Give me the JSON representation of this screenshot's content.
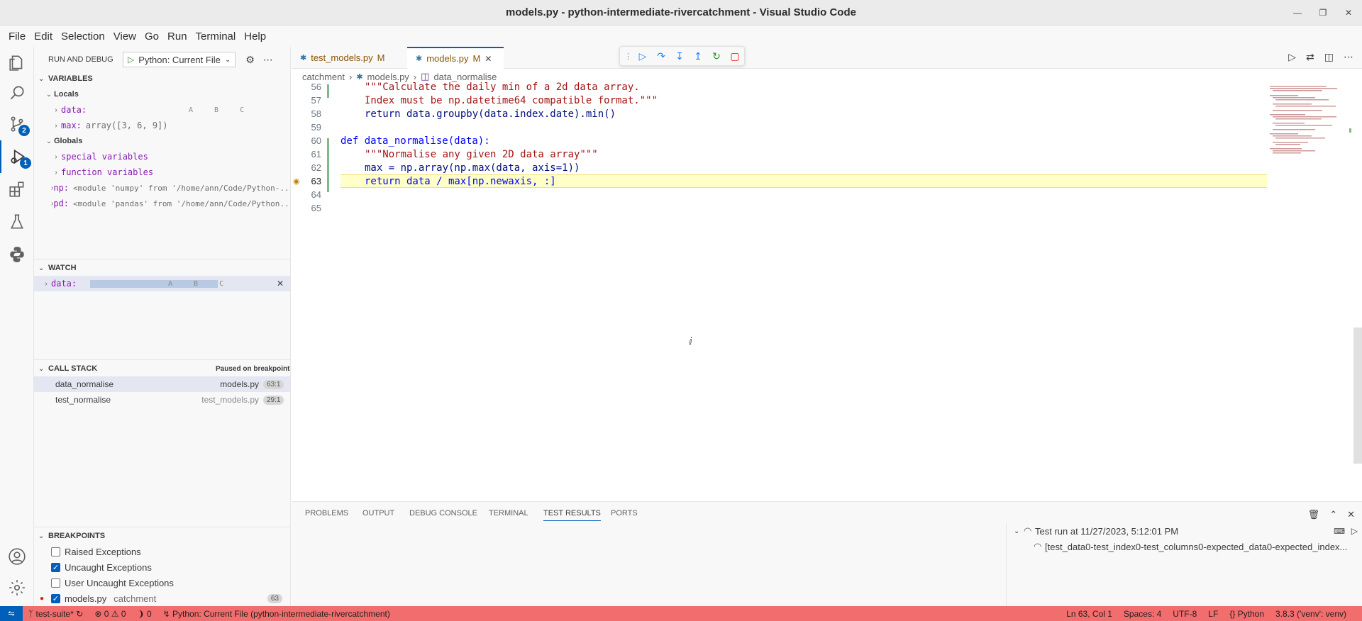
{
  "window": {
    "title": "models.py - python-intermediate-rivercatchment - Visual Studio Code"
  },
  "menu": [
    "File",
    "Edit",
    "Selection",
    "View",
    "Go",
    "Run",
    "Terminal",
    "Help"
  ],
  "activity": {
    "scm_badge": "2",
    "debug_badge": "1"
  },
  "sidebar": {
    "title": "RUN AND DEBUG",
    "config": "Python: Current File",
    "variables": {
      "header": "VARIABLES",
      "locals_label": "Locals",
      "locals": [
        {
          "name": "data:",
          "value": "A B C"
        },
        {
          "name": "max:",
          "value": "array([3, 6, 9])"
        }
      ],
      "globals_label": "Globals",
      "globals": [
        {
          "name": "special variables"
        },
        {
          "name": "function variables"
        },
        {
          "name": "np:",
          "value": "<module 'numpy' from '/home/ann/Code/Python-..."
        },
        {
          "name": "pd:",
          "value": "<module 'pandas' from '/home/ann/Code/Python..."
        }
      ]
    },
    "watch": {
      "header": "WATCH",
      "items": [
        {
          "name": "data:",
          "value": "A B C"
        }
      ]
    },
    "callstack": {
      "header": "CALL STACK",
      "status": "Paused on breakpoint",
      "frames": [
        {
          "fn": "data_normalise",
          "file": "models.py",
          "pos": "63:1"
        },
        {
          "fn": "test_normalise",
          "file": "test_models.py",
          "pos": "29:1"
        }
      ]
    },
    "breakpoints": {
      "header": "BREAKPOINTS",
      "items": [
        {
          "label": "Raised Exceptions",
          "checked": false
        },
        {
          "label": "Uncaught Exceptions",
          "checked": true
        },
        {
          "label": "User Uncaught Exceptions",
          "checked": false
        }
      ],
      "file": {
        "name": "models.py",
        "folder": "catchment",
        "line": "63"
      }
    }
  },
  "tabs": [
    {
      "label": "test_models.py",
      "mod": "M"
    },
    {
      "label": "models.py",
      "mod": "M"
    }
  ],
  "breadcrumb": [
    "catchment",
    "models.py",
    "data_normalise"
  ],
  "editor": {
    "lines": [
      {
        "n": "56",
        "text": "\"\"\"Calculate the daily min of a 2d data array."
      },
      {
        "n": "57",
        "text": "Index must be np.datetime64 compatible format.\"\"\""
      },
      {
        "n": "58",
        "text": "return data.groupby(data.index.date).min()"
      },
      {
        "n": "59",
        "text": ""
      },
      {
        "n": "60",
        "text": "def data_normalise(data):"
      },
      {
        "n": "61",
        "text": "\"\"\"Normalise any given 2D data array\"\"\""
      },
      {
        "n": "62",
        "text": "max = np.array(np.max(data, axis=1))"
      },
      {
        "n": "63",
        "text": "return data / max[np.newaxis, :]"
      },
      {
        "n": "64",
        "text": ""
      },
      {
        "n": "65",
        "text": ""
      }
    ]
  },
  "panel": {
    "tabs": [
      "PROBLEMS",
      "OUTPUT",
      "DEBUG CONSOLE",
      "TERMINAL",
      "TEST RESULTS",
      "PORTS"
    ],
    "test_run": "Test run at 11/27/2023, 5:12:01 PM",
    "test_case": "[test_data0-test_index0-test_columns0-expected_data0-expected_index..."
  },
  "status": {
    "branch": "test-suite*",
    "errors": "0",
    "warnings": "0",
    "ports": "0",
    "debug": "Python: Current File (python-intermediate-rivercatchment)",
    "position": "Ln 63, Col 1",
    "spaces": "Spaces: 4",
    "encoding": "UTF-8",
    "eol": "LF",
    "language": "Python",
    "interpreter": "3.8.3 ('venv': venv)"
  },
  "colors": {
    "accent": "#005fb8",
    "statusbar_debug": "#f26d6d"
  }
}
